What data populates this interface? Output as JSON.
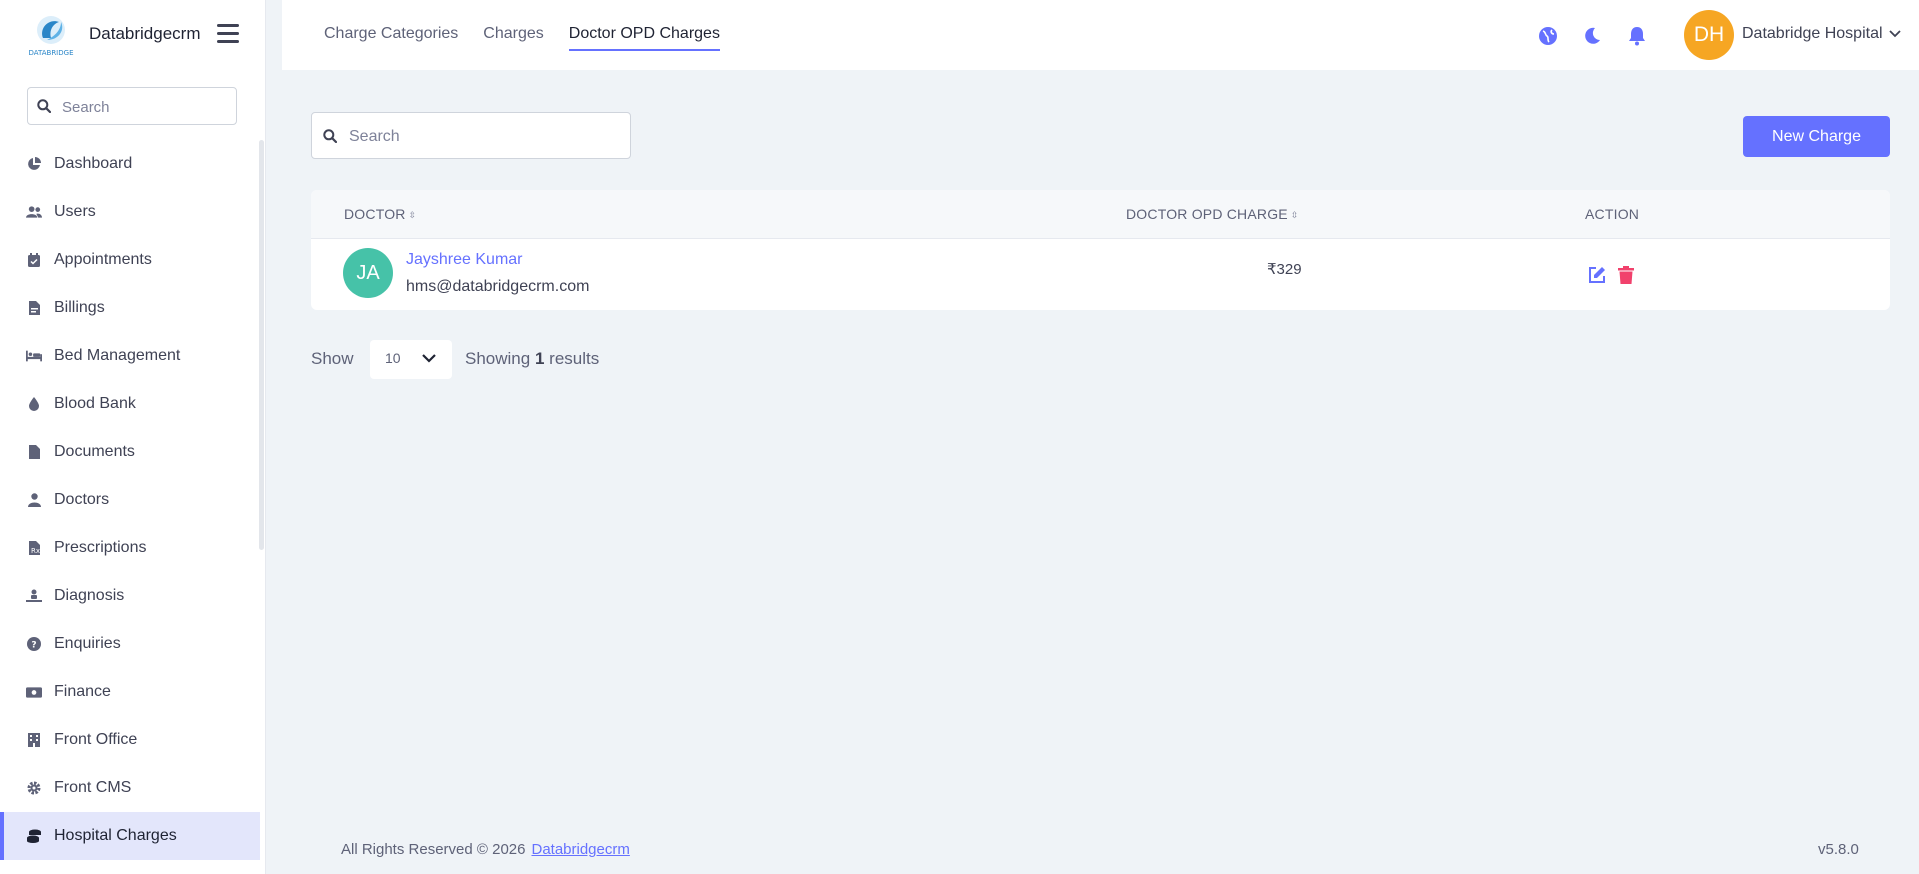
{
  "brand": {
    "name": "Databridgecrm",
    "logo_text": "DATABRIDGE"
  },
  "sidebar": {
    "search_placeholder": "Search",
    "items": [
      {
        "label": "Dashboard",
        "icon": "chart-pie-icon"
      },
      {
        "label": "Users",
        "icon": "users-icon"
      },
      {
        "label": "Appointments",
        "icon": "calendar-check-icon"
      },
      {
        "label": "Billings",
        "icon": "file-invoice-icon"
      },
      {
        "label": "Bed Management",
        "icon": "bed-icon"
      },
      {
        "label": "Blood Bank",
        "icon": "droplet-icon"
      },
      {
        "label": "Documents",
        "icon": "file-icon"
      },
      {
        "label": "Doctors",
        "icon": "user-doctor-icon"
      },
      {
        "label": "Prescriptions",
        "icon": "prescription-icon"
      },
      {
        "label": "Diagnosis",
        "icon": "diagnoses-icon"
      },
      {
        "label": "Enquiries",
        "icon": "question-circle-icon"
      },
      {
        "label": "Finance",
        "icon": "money-bill-icon"
      },
      {
        "label": "Front Office",
        "icon": "building-icon"
      },
      {
        "label": "Front CMS",
        "icon": "gear-icon"
      },
      {
        "label": "Hospital Charges",
        "icon": "coins-icon",
        "active": true
      }
    ]
  },
  "header": {
    "tabs": [
      {
        "label": "Charge Categories"
      },
      {
        "label": "Charges"
      },
      {
        "label": "Doctor OPD Charges",
        "active": true
      }
    ],
    "avatar_initials": "DH",
    "user_name": "Databridge Hospital"
  },
  "main": {
    "search_placeholder": "Search",
    "new_button_label": "New Charge",
    "table": {
      "columns": [
        "DOCTOR",
        "DOCTOR OPD CHARGE",
        "ACTION"
      ],
      "rows": [
        {
          "initials": "JA",
          "name": "Jayshree Kumar",
          "email": "hms@databridgecrm.com",
          "charge": "₹329"
        }
      ]
    },
    "pagination": {
      "show_label": "Show",
      "per_page": "10",
      "showing_prefix": "Showing",
      "showing_count": "1",
      "showing_suffix": "results"
    }
  },
  "footer": {
    "text": "All Rights Reserved © 2026",
    "link": "Databridgecrm",
    "version": "v5.8.0"
  },
  "colors": {
    "accent": "#6571ff",
    "avatar_top": "#f6a623",
    "avatar_doc": "#46c2a8",
    "delete": "#f1416c",
    "background": "#eff3f7"
  }
}
